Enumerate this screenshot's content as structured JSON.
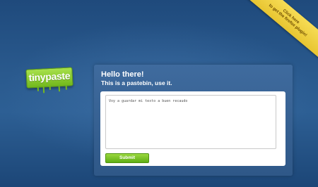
{
  "logo": {
    "text": "tinypaste"
  },
  "ribbon": {
    "line1": "Click here",
    "line2": "to get the firefox plugin!"
  },
  "panel": {
    "heading": "Hello there!",
    "subheading": "This is a pastebin, use it.",
    "textarea_value": "Voy a guardar mi texto a buen recaudo",
    "submit_label": "Submit"
  },
  "colors": {
    "background": "#2a5a8e",
    "panel": "#3a6698",
    "brand_green": "#7ec227",
    "ribbon_yellow": "#f2d544"
  }
}
